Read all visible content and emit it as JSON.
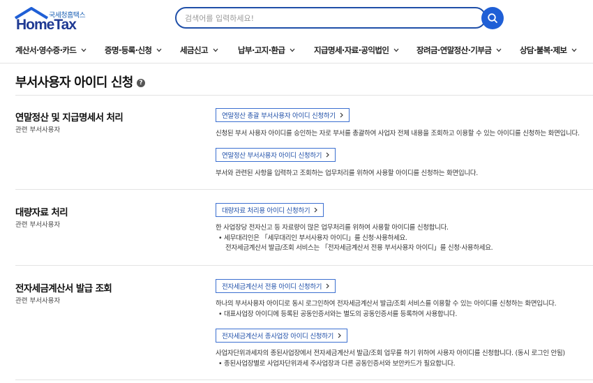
{
  "header": {
    "logo_sub": "국세청홈택스",
    "logo_main": "HomeTax",
    "search_placeholder": "검색어를 입력하세요!",
    "search_value": ""
  },
  "nav": {
    "items": [
      {
        "label": "계산서·영수증·카드"
      },
      {
        "label": "증명·등록·신청"
      },
      {
        "label": "세금신고"
      },
      {
        "label": "납부·고지·환급"
      },
      {
        "label": "지급명세·자료·공익법인"
      },
      {
        "label": "장려금·연말정산·기부금"
      },
      {
        "label": "상담·불복·제보"
      }
    ]
  },
  "page": {
    "title": "부서사용자 아이디 신청",
    "help_glyph": "?"
  },
  "sections": [
    {
      "title": "연말정산 및 지급명세서 처리",
      "subtitle": "관련 부서사용자",
      "groups": [
        {
          "button": "연말정산 총괄 부서사용자 아이디 신청하기",
          "desc": "신청된 부서 사용자 아이디를 승인하는 자로 부서를 총괄하여 사업자 전체 내용을 조회하고 이용할 수 있는 아이디를 신청하는 화면입니다."
        },
        {
          "button": "연말정산 부서사용자 아이디 신청하기",
          "desc": "부서와 관련된 사항을 입력하고 조회하는 업무처리를 위하여 사용할 아이디를 신청하는 화면입니다."
        }
      ]
    },
    {
      "title": "대량자료 처리",
      "subtitle": "관련 부서사용자",
      "groups": [
        {
          "button": "대량자료 처리용 아이디 신청하기",
          "desc": "한 사업장당 전자신고 등 자료량이 많은 업무처리를 위하여 사용할 아이디를 신청합니다.",
          "bullet": "세무대리인은 「세무대리인 부서사용자 아이디」를 신청·사용하세요.",
          "bullet_cont": "전자세금계산서 발급/조회 서비스는 「전자세금계산서 전용 부서사용자 아이디」를 신청·사용하세요."
        }
      ]
    },
    {
      "title": "전자세금계산서 발급 조회",
      "subtitle": "관련 부서사용자",
      "groups": [
        {
          "button": "전자세금계산서 전용 아이디 신청하기",
          "desc": "하나의 부서사용자 아이디로 동시 로그인하여 전자세금계산서 발급/조회 서비스를 이용할 수 있는 아이디를 신청하는 화면입니다.",
          "bullet": "대표사업장 아이디에 등록된 공동인증서와는 별도의 공동인증서를 등록하여 사용합니다."
        },
        {
          "button": "전자세금계산서 종사업장 아이디 신청하기",
          "desc": "사업자단위과세자의 종된사업장에서 전자세금계산서 발급/조회 업무를 하기 위하여 사용자 아이디를 신청합니다. (동시 로그인 안됨)",
          "bullet": "종된사업장별로 사업자단위과세 주사업장과 다른 공동인증서와 보안카드가 필요합니다."
        }
      ]
    }
  ]
}
